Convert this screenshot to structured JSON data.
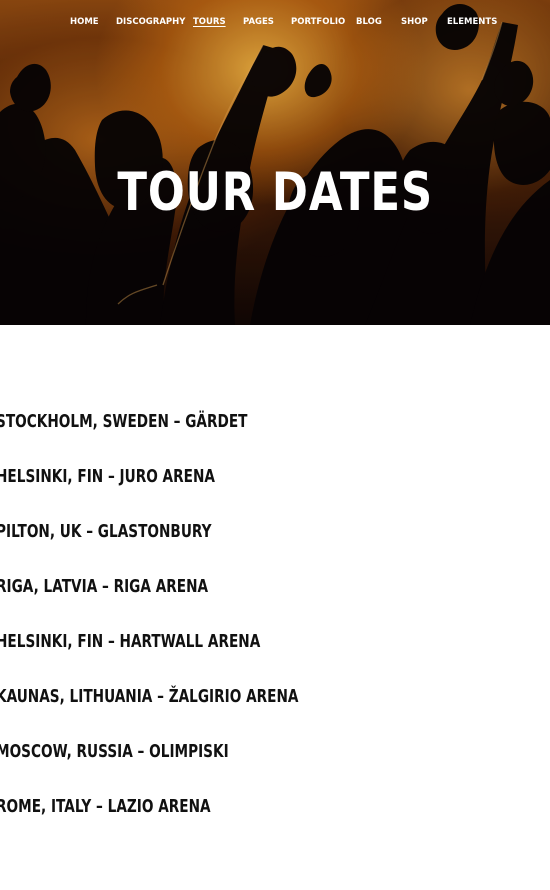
{
  "nav": {
    "items": [
      {
        "label": "HOME",
        "active": false
      },
      {
        "label": "DISCOGRAPHY",
        "active": false
      },
      {
        "label": "TOURS",
        "active": true
      },
      {
        "label": "PAGES",
        "active": false
      },
      {
        "label": "PORTFOLIO",
        "active": false
      },
      {
        "label": "BLOG",
        "active": false
      },
      {
        "label": "SHOP",
        "active": false
      },
      {
        "label": "ELEMENTS",
        "active": false
      }
    ]
  },
  "hero": {
    "title": "TOUR DATES"
  },
  "tours": [
    {
      "label": "STOCKHOLM, SWEDEN – GÄRDET"
    },
    {
      "label": "HELSINKI, FIN – JURO ARENA"
    },
    {
      "label": "PILTON, UK – GLASTONBURY"
    },
    {
      "label": "RIGA, LATVIA – RIGA ARENA"
    },
    {
      "label": "HELSINKI, FIN – HARTWALL ARENA"
    },
    {
      "label": "KAUNAS, LITHUANIA – ŽALGIRIO ARENA"
    },
    {
      "label": "MOSCOW, RUSSIA – OLIMPISKI"
    },
    {
      "label": "ROME, ITALY – LAZIO ARENA"
    }
  ]
}
